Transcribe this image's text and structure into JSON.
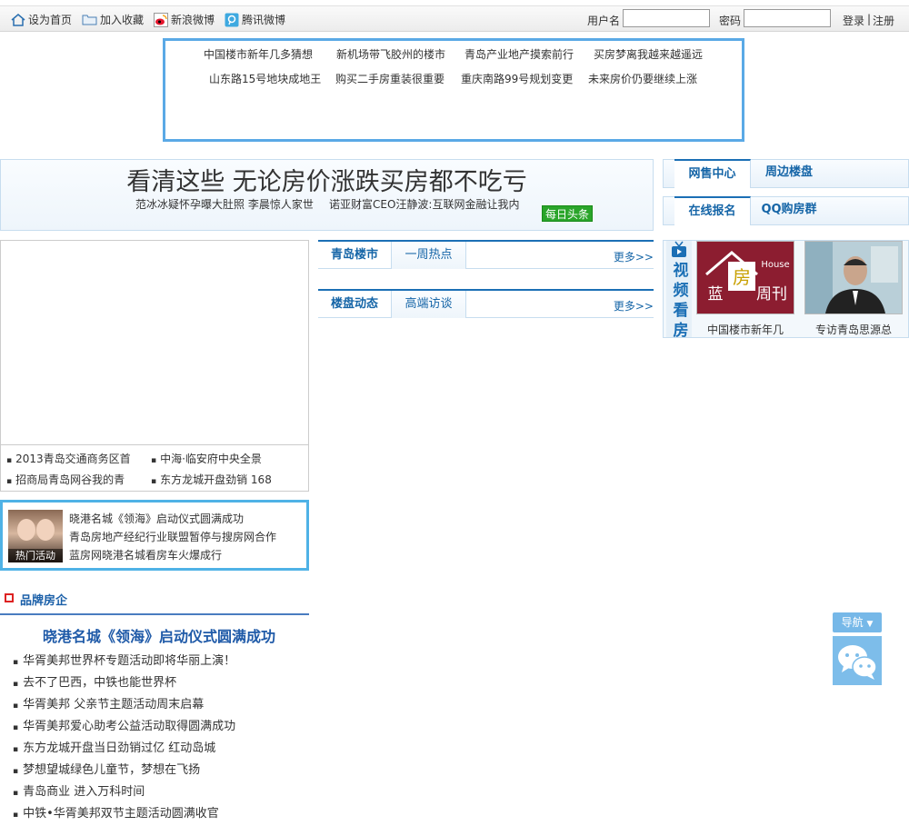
{
  "topbar": {
    "home": "设为首页",
    "favorite": "加入收藏",
    "weibo_sina": "新浪微博",
    "weibo_tencent": "腾讯微博",
    "username_label": "用户名",
    "password_label": "密码",
    "login": "登录",
    "divider": "|",
    "register": "注册"
  },
  "keywords": [
    "中国楼市新年几多猜想",
    "新机场带飞胶州的楼市",
    "青岛产业地产摸索前行",
    "买房梦离我越来越遥远",
    "山东路15号地块成地王",
    "购买二手房重装很重要",
    "重庆南路99号规划变更",
    "未来房价仍要继续上涨"
  ],
  "headline": {
    "title": "看清这些 无论房价涨跌买房都不吃亏",
    "sub1": "范冰冰疑怀孕曝大肚照 李晨惊人家世",
    "sub2": "诺亚财富CEO汪静波:互联网金融让我内",
    "badge": "每日头条"
  },
  "right_tabs_1": [
    "网售中心",
    "周边楼盘"
  ],
  "right_tabs_2": [
    "在线报名",
    "QQ购房群"
  ],
  "focus_list": [
    "2013青岛交通商务区首",
    "中海·临安府中央全景",
    "招商局青岛网谷我的青",
    "东方龙城开盘劲销 168"
  ],
  "hot": {
    "caption": "热门活动",
    "lines": [
      "晓港名城《领海》启动仪式圆满成功",
      "青岛房地产经纪行业联盟暂停与搜房网合作",
      "蓝房网晓港名城看房车火爆成行"
    ]
  },
  "brand": {
    "heading": "品牌房企",
    "title": "晓港名城《领海》启动仪式圆满成功",
    "items": [
      "华胥美邦世界杯专题活动即将华丽上演！",
      "去不了巴西，中铁也能世界杯",
      "华胥美邦 父亲节主题活动周末启幕",
      "华胥美邦爱心助考公益活动取得圆满成功",
      "东方龙城开盘当日劲销过亿 红动岛城",
      "梦想望城绿色儿童节，梦想在飞扬",
      "青岛商业 进入万科时间",
      "中铁•华胥美邦双节主题活动圆满收官"
    ]
  },
  "middle": {
    "section1": {
      "tabs": [
        "青岛楼市",
        "一周热点"
      ],
      "more": "更多>>"
    },
    "section2": {
      "tabs": [
        "楼盘动态",
        "高端访谈"
      ],
      "more": "更多>>"
    }
  },
  "video": {
    "label": "视频看房",
    "logo_text": "蓝房周刊",
    "logo_house": "House",
    "captions": [
      "中国楼市新年几",
      "专访青岛思源总"
    ]
  },
  "float_nav": {
    "label": "导航"
  }
}
